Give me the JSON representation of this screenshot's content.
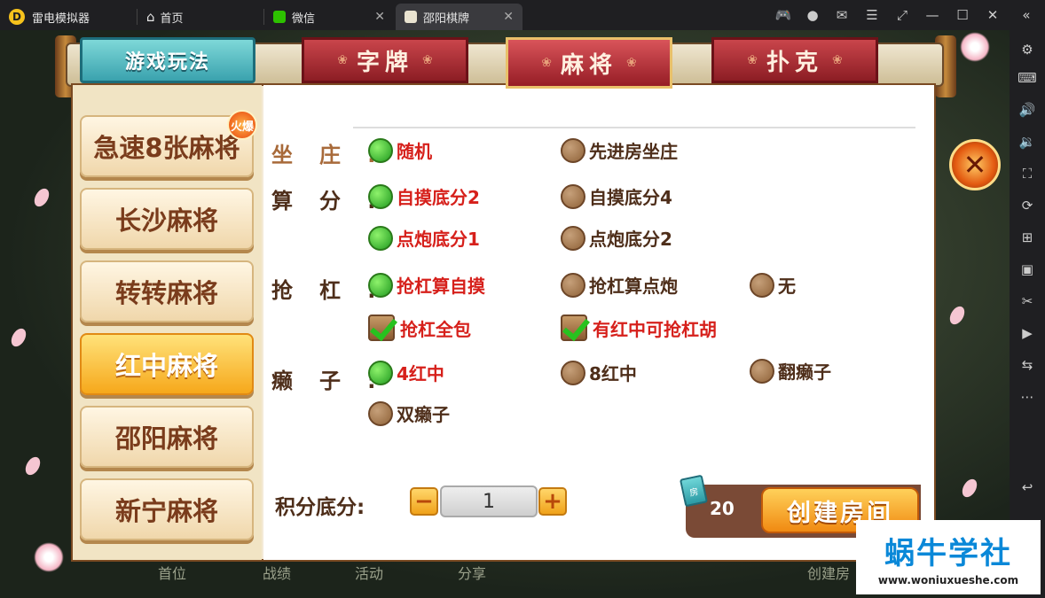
{
  "titlebar": {
    "app_name": "雷电模拟器",
    "app_icon_glyph": "D",
    "tabs": [
      {
        "label": "首页",
        "icon": "home-icon"
      },
      {
        "label": "微信",
        "icon": "wechat-icon"
      },
      {
        "label": "邵阳棋牌",
        "icon": "game-icon",
        "active": true
      }
    ]
  },
  "game": {
    "header": {
      "title": "游戏玩法",
      "tabs": [
        "字牌",
        "麻将",
        "扑克"
      ],
      "active_tab": "麻将"
    },
    "games": [
      {
        "label": "急速8张麻将",
        "badge": "火爆"
      },
      {
        "label": "长沙麻将"
      },
      {
        "label": "转转麻将"
      },
      {
        "label": "红中麻将",
        "active": true
      },
      {
        "label": "邵阳麻将"
      },
      {
        "label": "新宁麻将"
      }
    ],
    "options": {
      "zhuang": {
        "label": "坐庄:",
        "choices": [
          "随机",
          "先进房坐庄"
        ],
        "selected": "随机"
      },
      "suanfen": {
        "label": "算分:",
        "choices": [
          "自摸底分2",
          "自摸底分4",
          "点炮底分1",
          "点炮底分2"
        ],
        "selected": [
          "自摸底分2",
          "点炮底分1"
        ]
      },
      "qianggang": {
        "label": "抢杠:",
        "choices": [
          "抢杠算自摸",
          "抢杠算点炮",
          "无"
        ],
        "selected": "抢杠算自摸",
        "checks": [
          "抢杠全包",
          "有红中可抢杠胡"
        ]
      },
      "laizi": {
        "label": "癞子:",
        "choices": [
          "4红中",
          "8红中",
          "翻癞子",
          "双癞子"
        ],
        "selected": "4红中"
      }
    },
    "score": {
      "label": "积分底分:",
      "value": "1",
      "minus": "−",
      "plus": "+"
    },
    "create": {
      "cost": "20",
      "label": "创建房间",
      "card_glyph": "房"
    },
    "close_glyph": "✕",
    "bottom_faint": [
      "首位",
      "战绩",
      "活动",
      "分享",
      "创建房"
    ]
  },
  "watermark": {
    "title": "蜗牛学社",
    "url": "www.woniuxueshe.com"
  },
  "colors": {
    "accent_red": "#d6201b",
    "brown_text": "#4e2e1a",
    "teal": "#3aa2ae",
    "orange": "#f08a12"
  }
}
